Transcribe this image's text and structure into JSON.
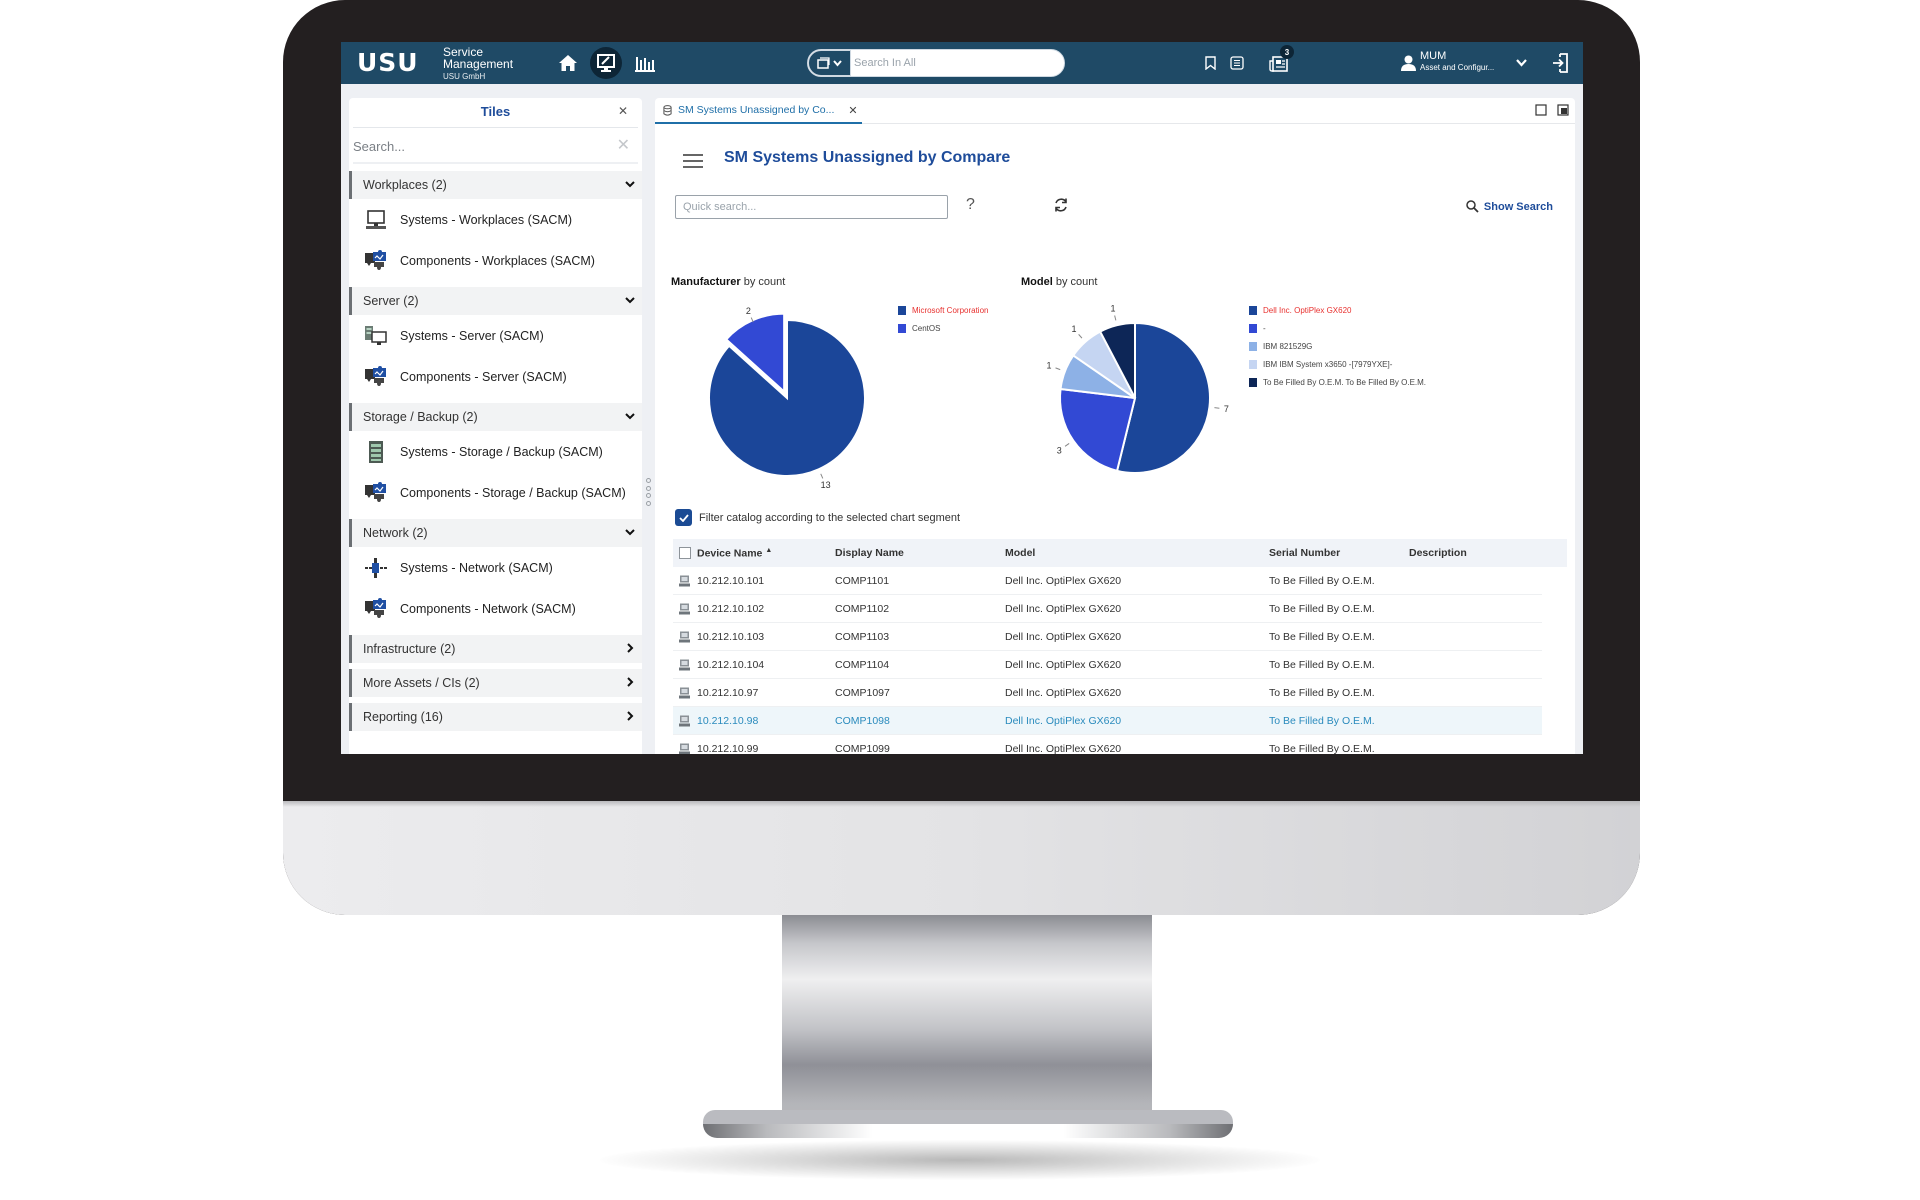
{
  "app": {
    "logo": "USU",
    "product_line1": "Service",
    "product_line2": "Management",
    "company": "USU GmbH"
  },
  "topbar": {
    "nav": [
      {
        "icon": "home-icon",
        "label": "Home"
      },
      {
        "icon": "workplace-monitor-icon",
        "label": "Workplace",
        "active": true
      },
      {
        "icon": "reports-chart-icon",
        "label": "Reports"
      }
    ],
    "search_placeholder": "Search In All",
    "search_value": "",
    "notifications_count": "3",
    "user": {
      "name": "MUM",
      "role": "Asset and Configur..."
    }
  },
  "tiles": {
    "title": "Tiles",
    "search_placeholder": "Search...",
    "groups": [
      {
        "label": "Workplaces (2)",
        "expanded": true,
        "items": [
          {
            "label": "Systems - Workplaces (SACM)",
            "icon": "desktop-computer-icon"
          },
          {
            "label": "Components - Workplaces (SACM)",
            "icon": "components-puzzle-icon"
          }
        ]
      },
      {
        "label": "Server (2)",
        "expanded": true,
        "items": [
          {
            "label": "Systems - Server (SACM)",
            "icon": "server-monitor-icon"
          },
          {
            "label": "Components - Server (SACM)",
            "icon": "components-puzzle-icon"
          }
        ]
      },
      {
        "label": "Storage / Backup (2)",
        "expanded": true,
        "items": [
          {
            "label": "Systems - Storage / Backup (SACM)",
            "icon": "storage-rack-icon"
          },
          {
            "label": "Components - Storage / Backup (SACM)",
            "icon": "components-puzzle-icon"
          }
        ]
      },
      {
        "label": "Network (2)",
        "expanded": true,
        "items": [
          {
            "label": "Systems - Network (SACM)",
            "icon": "network-node-icon"
          },
          {
            "label": "Components - Network (SACM)",
            "icon": "components-puzzle-icon"
          }
        ]
      },
      {
        "label": "Infrastructure (2)",
        "expanded": false,
        "items": []
      },
      {
        "label": "More Assets / CIs (2)",
        "expanded": false,
        "items": []
      },
      {
        "label": "Reporting (16)",
        "expanded": false,
        "items": []
      }
    ]
  },
  "main": {
    "tab_label": "SM Systems Unassigned by Co...",
    "page_title": "SM Systems Unassigned by Compare",
    "quick_search_placeholder": "Quick search...",
    "help_label": "?",
    "show_search_label": "Show Search",
    "filter_label": "Filter catalog according to the selected chart segment",
    "filter_checked": true,
    "table": {
      "columns": [
        "Device Name",
        "Display Name",
        "Model",
        "Serial Number",
        "Description"
      ],
      "sort_column": "Device Name",
      "sort_dir": "asc",
      "rows": [
        {
          "device": "10.212.10.101",
          "display": "COMP1101",
          "model": "Dell Inc. OptiPlex GX620",
          "serial": "To Be Filled By O.E.M.",
          "description": "",
          "selected": false
        },
        {
          "device": "10.212.10.102",
          "display": "COMP1102",
          "model": "Dell Inc. OptiPlex GX620",
          "serial": "To Be Filled By O.E.M.",
          "description": "",
          "selected": false
        },
        {
          "device": "10.212.10.103",
          "display": "COMP1103",
          "model": "Dell Inc. OptiPlex GX620",
          "serial": "To Be Filled By O.E.M.",
          "description": "",
          "selected": false
        },
        {
          "device": "10.212.10.104",
          "display": "COMP1104",
          "model": "Dell Inc. OptiPlex GX620",
          "serial": "To Be Filled By O.E.M.",
          "description": "",
          "selected": false
        },
        {
          "device": "10.212.10.97",
          "display": "COMP1097",
          "model": "Dell Inc. OptiPlex GX620",
          "serial": "To Be Filled By O.E.M.",
          "description": "",
          "selected": false
        },
        {
          "device": "10.212.10.98",
          "display": "COMP1098",
          "model": "Dell Inc. OptiPlex GX620",
          "serial": "To Be Filled By O.E.M.",
          "description": "",
          "selected": true
        },
        {
          "device": "10.212.10.99",
          "display": "COMP1099",
          "model": "Dell Inc. OptiPlex GX620",
          "serial": "To Be Filled By O.E.M.",
          "description": "",
          "selected": false
        }
      ]
    }
  },
  "colors": {
    "topbar": "#1f4a66",
    "title_blue": "#1e4c9a",
    "link_blue": "#1f6fa8",
    "selected_row_text": "#2a8bbd",
    "legend_highlight": "#e8312f"
  },
  "chart_data": [
    {
      "type": "pie",
      "title_bold": "Manufacturer",
      "title_rest": " by count",
      "categories": [
        "Microsoft Corporation",
        "CentOS"
      ],
      "values": [
        13,
        2
      ],
      "colors": [
        "#1b4699",
        "#3249d4"
      ],
      "highlighted": "Microsoft Corporation",
      "exploded": "CentOS",
      "legend": "right"
    },
    {
      "type": "pie",
      "title_bold": "Model",
      "title_rest": " by count",
      "categories": [
        "Dell Inc. OptiPlex GX620",
        "-",
        "IBM 821529G",
        "IBM IBM System x3650 -[7979YXE]-",
        "To Be Filled By O.E.M. To Be Filled By O.E.M."
      ],
      "values": [
        7,
        3,
        1,
        1,
        1
      ],
      "colors": [
        "#1b4699",
        "#3249d4",
        "#8db1e6",
        "#c5d5f2",
        "#0d2657"
      ],
      "highlighted": "Dell Inc. OptiPlex GX620",
      "legend": "right"
    }
  ]
}
